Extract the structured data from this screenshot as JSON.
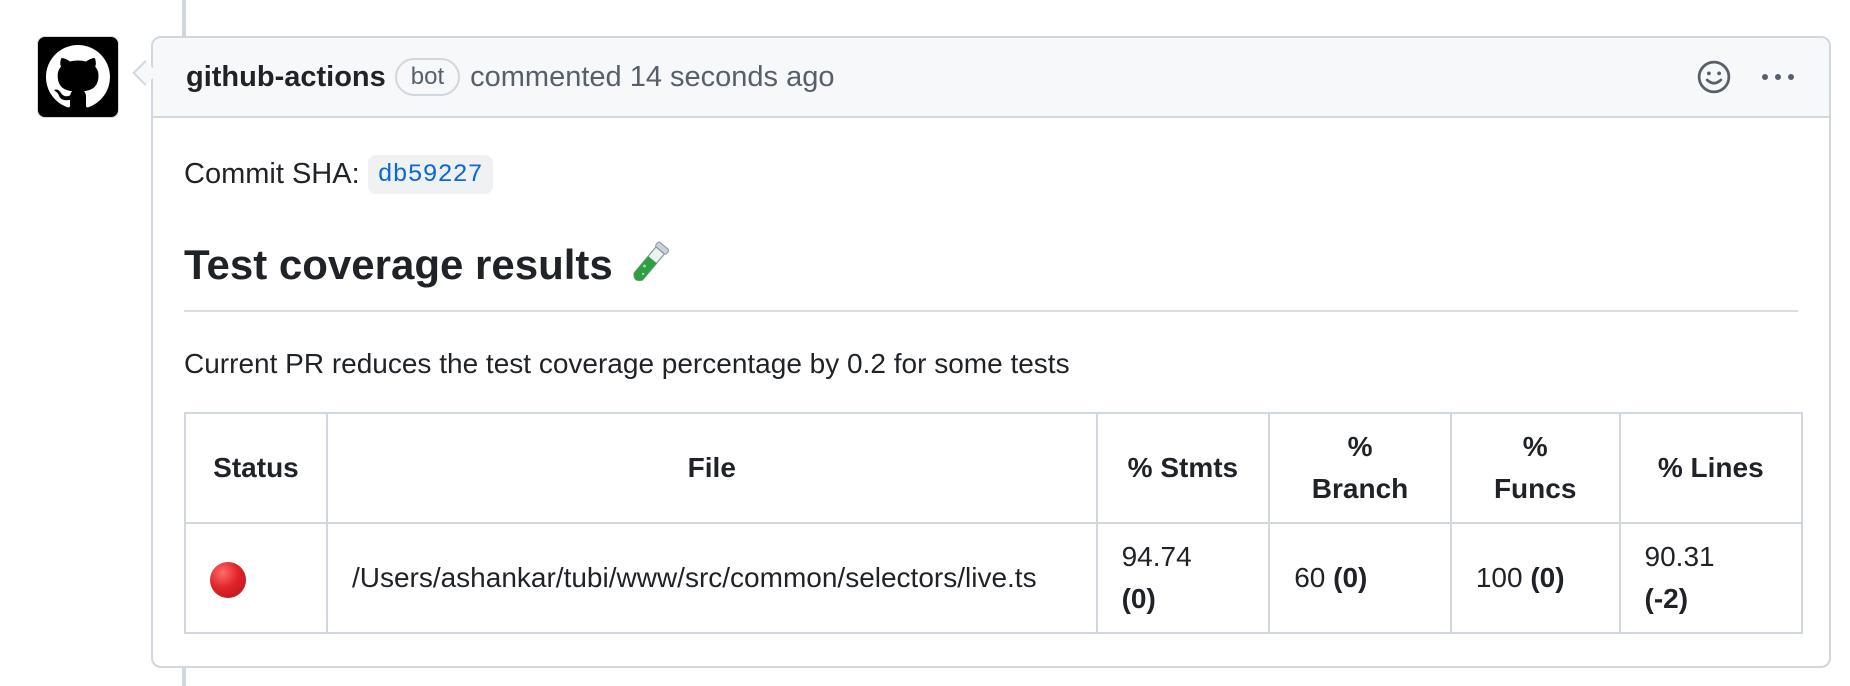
{
  "comment": {
    "author": "github-actions",
    "badge": "bot",
    "meta": "commented 14 seconds ago"
  },
  "body": {
    "commit_label": "Commit SHA:",
    "commit_sha": "db59227",
    "heading": "Test coverage results",
    "summary": "Current PR reduces the test coverage percentage by 0.2 for some tests"
  },
  "table": {
    "headers": {
      "status": "Status",
      "file": "File",
      "stmts": "% Stmts",
      "branch_pct": "%",
      "branch_word": "Branch",
      "funcs_pct": "%",
      "funcs_word": "Funcs",
      "lines": "% Lines"
    },
    "rows": [
      {
        "status_icon": "red-circle-icon",
        "file": "/Users/ashankar/tubi/www/src/common/selectors/live.ts",
        "stmts_value": "94.74",
        "stmts_delta": "(0)",
        "branch_value": "60",
        "branch_delta": "(0)",
        "funcs_value": "100",
        "funcs_delta": "(0)",
        "lines_value": "90.31",
        "lines_delta": "(-2)"
      }
    ]
  },
  "icons": {
    "avatar": "github-octocat-icon",
    "reaction": "smiley-icon",
    "menu": "kebab-horizontal-icon",
    "heading_emoji": "test-tube-icon"
  },
  "colors": {
    "link": "#0969da",
    "status_red": "#e0242a",
    "header_bg": "#f6f8fa",
    "border": "#d0d7de"
  }
}
